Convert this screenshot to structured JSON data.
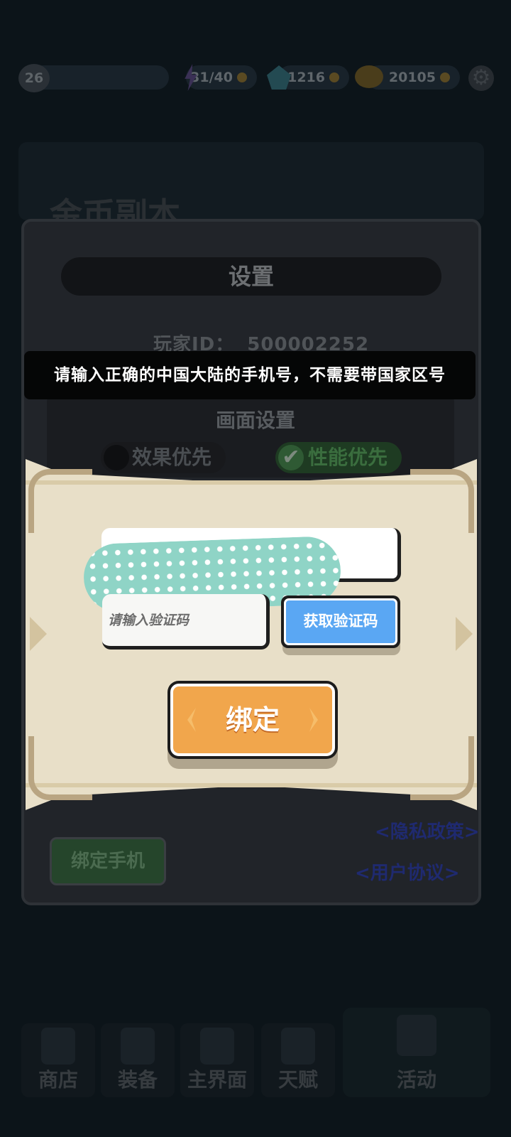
{
  "topbar": {
    "level": "26",
    "energy": "31/40",
    "gems": "1216",
    "gold": "20105"
  },
  "background": {
    "banner_title": "金币副本"
  },
  "settings": {
    "title": "设置",
    "player_id_label": "玩家ID：",
    "player_id_value": "500002252",
    "display_title": "画面设置",
    "option_effect": "效果优先",
    "option_performance": "性能优先",
    "selected_option": "性能优先",
    "bind_phone_button": "绑定手机",
    "privacy_link": "<隐私政策>",
    "user_agreement_link": "<用户协议>"
  },
  "toast": {
    "message": "请输入正确的中国大陆的手机号，不需要带国家区号"
  },
  "bind_dialog": {
    "phone_value": "",
    "code_placeholder": "请输入验证码",
    "get_code_button": "获取验证码",
    "bind_button": "绑定"
  },
  "bottom_nav": {
    "shop": "商店",
    "equipment": "装备",
    "main": "主界面",
    "talent": "天赋",
    "activity": "活动"
  },
  "colors": {
    "bind_button": "#f1a64c",
    "get_code_button": "#5aa7f3",
    "parchment": "#e8dfc8",
    "toast_bg": "#050606",
    "privacy_blot": "#8fd4c6"
  }
}
